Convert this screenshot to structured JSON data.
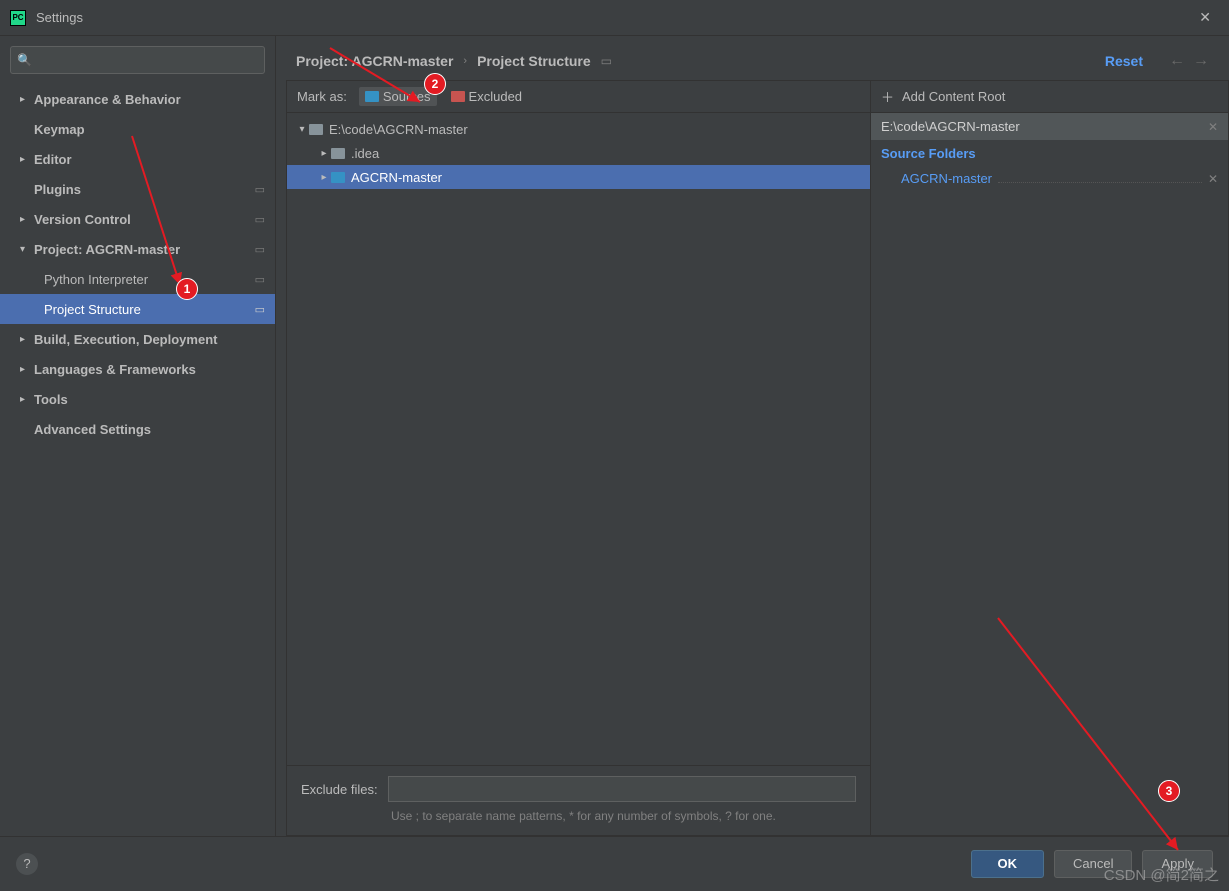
{
  "window": {
    "title": "Settings"
  },
  "sidebar": {
    "search_placeholder": "",
    "items": [
      {
        "label": "Appearance & Behavior",
        "expandable": true
      },
      {
        "label": "Keymap",
        "expandable": false
      },
      {
        "label": "Editor",
        "expandable": true
      },
      {
        "label": "Plugins",
        "expandable": false,
        "modified": true
      },
      {
        "label": "Version Control",
        "expandable": true,
        "modified": true
      },
      {
        "label": "Project: AGCRN-master",
        "expandable": true,
        "expanded": true,
        "modified": true,
        "children": [
          {
            "label": "Python Interpreter",
            "modified": true
          },
          {
            "label": "Project Structure",
            "modified": true,
            "selected": true
          }
        ]
      },
      {
        "label": "Build, Execution, Deployment",
        "expandable": true
      },
      {
        "label": "Languages & Frameworks",
        "expandable": true
      },
      {
        "label": "Tools",
        "expandable": true
      },
      {
        "label": "Advanced Settings",
        "expandable": false
      }
    ]
  },
  "breadcrumb": {
    "project_label": "Project: AGCRN-master",
    "page_label": "Project Structure",
    "reset_label": "Reset"
  },
  "markbar": {
    "label": "Mark as:",
    "sources_label": "Sources",
    "excluded_label": "Excluded"
  },
  "tree": {
    "root": "E:\\code\\AGCRN-master",
    "children": [
      {
        "name": ".idea",
        "type": "gray"
      },
      {
        "name": "AGCRN-master",
        "type": "blue",
        "selected": true
      }
    ]
  },
  "exclude": {
    "label": "Exclude files:",
    "value": "",
    "hint": "Use ; to separate name patterns, * for any number of symbols, ? for one."
  },
  "rightpanel": {
    "add_label": "Add Content Root",
    "root_path": "E:\\code\\AGCRN-master",
    "section_label": "Source Folders",
    "item": "AGCRN-master"
  },
  "footer": {
    "ok": "OK",
    "cancel": "Cancel",
    "apply": "Apply"
  },
  "annotations": {
    "n1": "1",
    "n2": "2",
    "n3": "3"
  },
  "watermark": "CSDN @简2简之"
}
